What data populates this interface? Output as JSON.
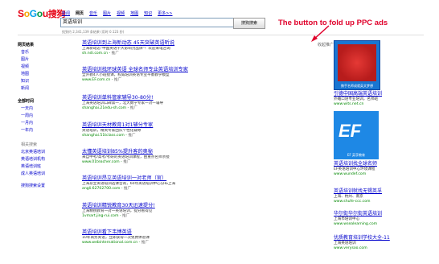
{
  "logo": {
    "parts": [
      "S",
      "o",
      "G",
      "o",
      "u"
    ],
    "cn": "搜狗"
  },
  "tabs": [
    {
      "label": "新闻"
    },
    {
      "label": "网页"
    },
    {
      "label": "音乐"
    },
    {
      "label": "图片"
    },
    {
      "label": "视频"
    },
    {
      "label": "地图"
    },
    {
      "label": "知识"
    },
    {
      "label": "更多>>"
    }
  ],
  "search": {
    "value": "英语培训",
    "button": "搜狗搜索"
  },
  "stats": "找到约 2,341,139 条结果 (用时 0.123 秒)",
  "sidebar": {
    "heading1": "网页结果",
    "items1": [
      "音乐",
      "图片",
      "视频",
      "地图",
      "知识",
      "新闻"
    ],
    "heading2": "全部时间",
    "items2": [
      "一天内",
      "一周内",
      "一月内",
      "一年内"
    ],
    "sub": "相关搜索",
    "items3": [
      "北京英语培训",
      "英语培训机构",
      "英语培训班",
      "成人英语培训"
    ],
    "footer": "搜狗搜索设置"
  },
  "annotation": "The button to fold up PPC ads",
  "ad_label": "收起推广",
  "results": [
    {
      "title": "英语培训到上海新动态 45天突破英语听说",
      "snippet": "上海新动态\"中国英语十大影响力品牌\"！欢迎来电咨询",
      "url": "sh.ndi.com.cn",
      "tag": "推广"
    },
    {
      "title": "英语培训找环球英语 全球名师专业英语培训专家",
      "snippet": "全外教4人小班授课，权威培训英语专业平衡教学模型",
      "url": "www.EF.com.cn",
      "tag": "推广"
    },
    {
      "title": "英语培训单科管家辅导30-80分!",
      "snippet": "上海英语培训口碑第一，北大数学专家一对一辅导",
      "url": "shanghai.21edu-sh.com",
      "tag": "推广"
    },
    {
      "title": "英语培训天材教育1对1辅分专家",
      "snippet": "英语培训，精英专家团队个性化辅导",
      "url": "shanghai.51tclass.com",
      "tag": "推广"
    },
    {
      "title": "太懂英语培训85%提升客的奥秘",
      "snippet": "来自中考/高考/考研的英语培训课程，由重点名师亲授",
      "url": "www.01teacher.com",
      "tag": "推广"
    },
    {
      "title": "英语培训昂立英语培训一对老师（官）",
      "snippet": "上海昂立英语培训选课咨询，60年英语培训中心分布上海",
      "url": "angli.62702700.com",
      "tag": "推广"
    },
    {
      "title": "英语培训精锐教育30天迅速提分!",
      "snippet": "上海精锐教育一对一英语培训，提分看得见",
      "url": "1vmart.jing-rui.com",
      "tag": "推广"
    },
    {
      "title": "英语培训看下韦博英语",
      "snippet": "10年商务英语，立即获得一次免费体验课",
      "url": "www.webinternational.com.cn",
      "tag": "推广"
    }
  ],
  "ads": [
    {
      "title": "引德中国高端英语培训",
      "snippet": "外籍口语专业培训，名师班",
      "url": "www.wits.net.cn",
      "img_cap": "携手名师成就英文梦想"
    },
    {
      "title": "英语培训找全球名师",
      "snippet": "EF英语培训中心环境课程",
      "url": "www.wundef.com",
      "img_cap": "EF 英孚教育"
    },
    {
      "title": "英语培训就找无锡英孚",
      "snippet": "上海、杭州、南京",
      "url": "www.shufe-ccc.com"
    },
    {
      "title": "华尔街华尔街英语培训",
      "snippet": "上海市培训中心",
      "url": "www.wsealearning.com"
    },
    {
      "title": "优质教育培训学校大全-11",
      "snippet": "上海英语培训",
      "url": "www.verysoo.com"
    }
  ]
}
